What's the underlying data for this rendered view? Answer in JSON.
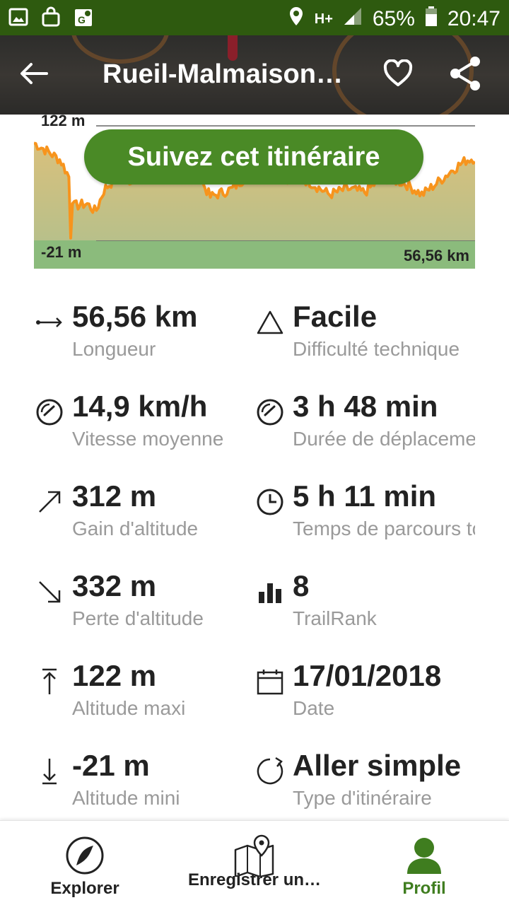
{
  "status_bar": {
    "battery": "65%",
    "time": "20:47",
    "network": "H+"
  },
  "header": {
    "title": "Rueil-Malmaison…",
    "icons": [
      "back-arrow-icon",
      "heart-icon",
      "share-icon"
    ]
  },
  "elevation": {
    "max_label": "122 m",
    "min_label": "-21 m",
    "distance_label": "56,56 km",
    "line_color": "#f7941d"
  },
  "follow_button": {
    "label": "Suivez cet itinéraire",
    "color": "#4a8a26"
  },
  "stats": {
    "length": {
      "value": "56,56 km",
      "label": "Longueur",
      "icon": "length-arrow-icon"
    },
    "difficulty": {
      "value": "Facile",
      "label": "Difficulté technique",
      "icon": "triangle-icon"
    },
    "speed": {
      "value": "14,9 km/h",
      "label": "Vitesse moyenne",
      "icon": "speedometer-icon"
    },
    "moving_time": {
      "value": "3 h 48 min",
      "label": "Durée de déplacement",
      "icon": "speedometer-icon"
    },
    "gain": {
      "value": "312 m",
      "label": "Gain d'altitude",
      "icon": "arrow-up-right-icon"
    },
    "total_time": {
      "value": "5 h 11 min",
      "label": "Temps de parcours total",
      "icon": "clock-icon"
    },
    "loss": {
      "value": "332 m",
      "label": "Perte d'altitude",
      "icon": "arrow-down-right-icon"
    },
    "trailrank": {
      "value": "8",
      "label": "TrailRank",
      "icon": "bar-chart-icon"
    },
    "max_alt": {
      "value": "122 m",
      "label": "Altitude maxi",
      "icon": "arrow-up-bar-icon"
    },
    "date": {
      "value": "17/01/2018",
      "label": "Date",
      "icon": "calendar-icon"
    },
    "min_alt": {
      "value": "-21 m",
      "label": "Altitude mini",
      "icon": "arrow-down-bar-icon"
    },
    "route_type": {
      "value": "Aller simple",
      "label": "Type d'itinéraire",
      "icon": "circular-arrow-icon"
    }
  },
  "bottom_nav": {
    "explore": "Explorer",
    "record": "Enregistrer un…",
    "profile": "Profil",
    "accent": "#3f7d1f"
  }
}
